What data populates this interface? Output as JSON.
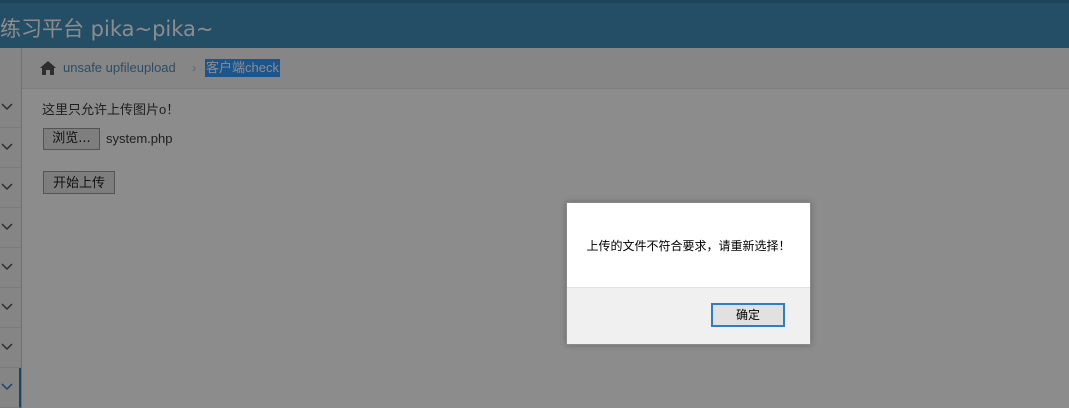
{
  "header": {
    "title": "练习平台 pika~pika~"
  },
  "breadcrumb": {
    "home_icon": "home-icon",
    "link_label": "unsafe upfileupload",
    "separator": "›",
    "active_label": "客户端check"
  },
  "sidebar": {
    "items": [
      {
        "icon": "chevron-down-icon"
      },
      {
        "icon": "chevron-down-icon"
      },
      {
        "icon": "chevron-down-icon"
      },
      {
        "icon": "chevron-down-icon"
      },
      {
        "icon": "chevron-down-icon"
      },
      {
        "icon": "chevron-down-icon"
      },
      {
        "icon": "chevron-down-icon"
      },
      {
        "icon": "chevron-down-icon"
      }
    ]
  },
  "main": {
    "hint_text": "这里只允许上传图片o！",
    "browse_label": "浏览...",
    "file_name": "system.php",
    "upload_label": "开始上传"
  },
  "dialog": {
    "message": "上传的文件不符合要求，请重新选择！",
    "ok_label": "确定"
  },
  "colors": {
    "header_bg": "#438eb9",
    "link": "#4c8fbd",
    "selection": "#3399ff",
    "focus_border": "#2e7dc5"
  }
}
